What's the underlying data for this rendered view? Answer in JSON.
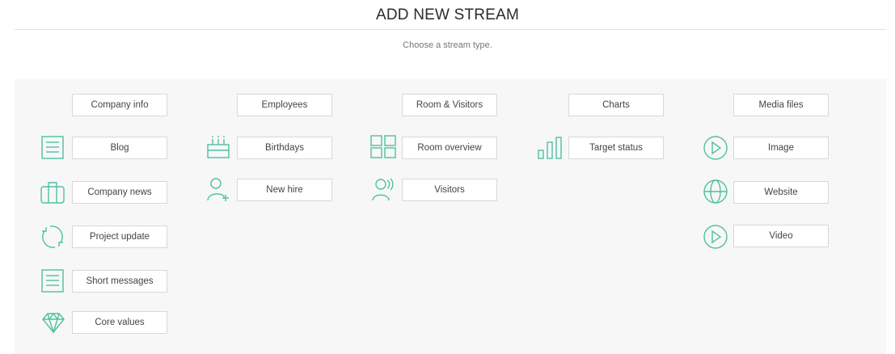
{
  "page": {
    "title": "ADD NEW STREAM",
    "subtitle": "Choose a stream type."
  },
  "accent_color": "#4ec1a0",
  "columns": [
    {
      "header": "Company info",
      "items": [
        {
          "label": "Blog",
          "icon": "document-lines-icon"
        },
        {
          "label": "Company news",
          "icon": "briefcase-icon"
        },
        {
          "label": "Project update",
          "icon": "refresh-cycle-icon"
        },
        {
          "label": "Short messages",
          "icon": "document-lines-icon"
        },
        {
          "label": "Core values",
          "icon": "diamond-icon"
        }
      ]
    },
    {
      "header": "Employees",
      "items": [
        {
          "label": "Birthdays",
          "icon": "birthday-cake-icon"
        },
        {
          "label": "New hire",
          "icon": "add-user-icon"
        }
      ]
    },
    {
      "header": "Room & Visitors",
      "items": [
        {
          "label": "Room overview",
          "icon": "grid-icon"
        },
        {
          "label": "Visitors",
          "icon": "visitor-icon"
        }
      ]
    },
    {
      "header": "Charts",
      "items": [
        {
          "label": "Target status",
          "icon": "bar-chart-icon"
        }
      ]
    },
    {
      "header": "Media files",
      "items": [
        {
          "label": "Image",
          "icon": "play-circle-icon"
        },
        {
          "label": "Website",
          "icon": "globe-icon"
        },
        {
          "label": "Video",
          "icon": "play-circle-icon"
        }
      ]
    }
  ]
}
